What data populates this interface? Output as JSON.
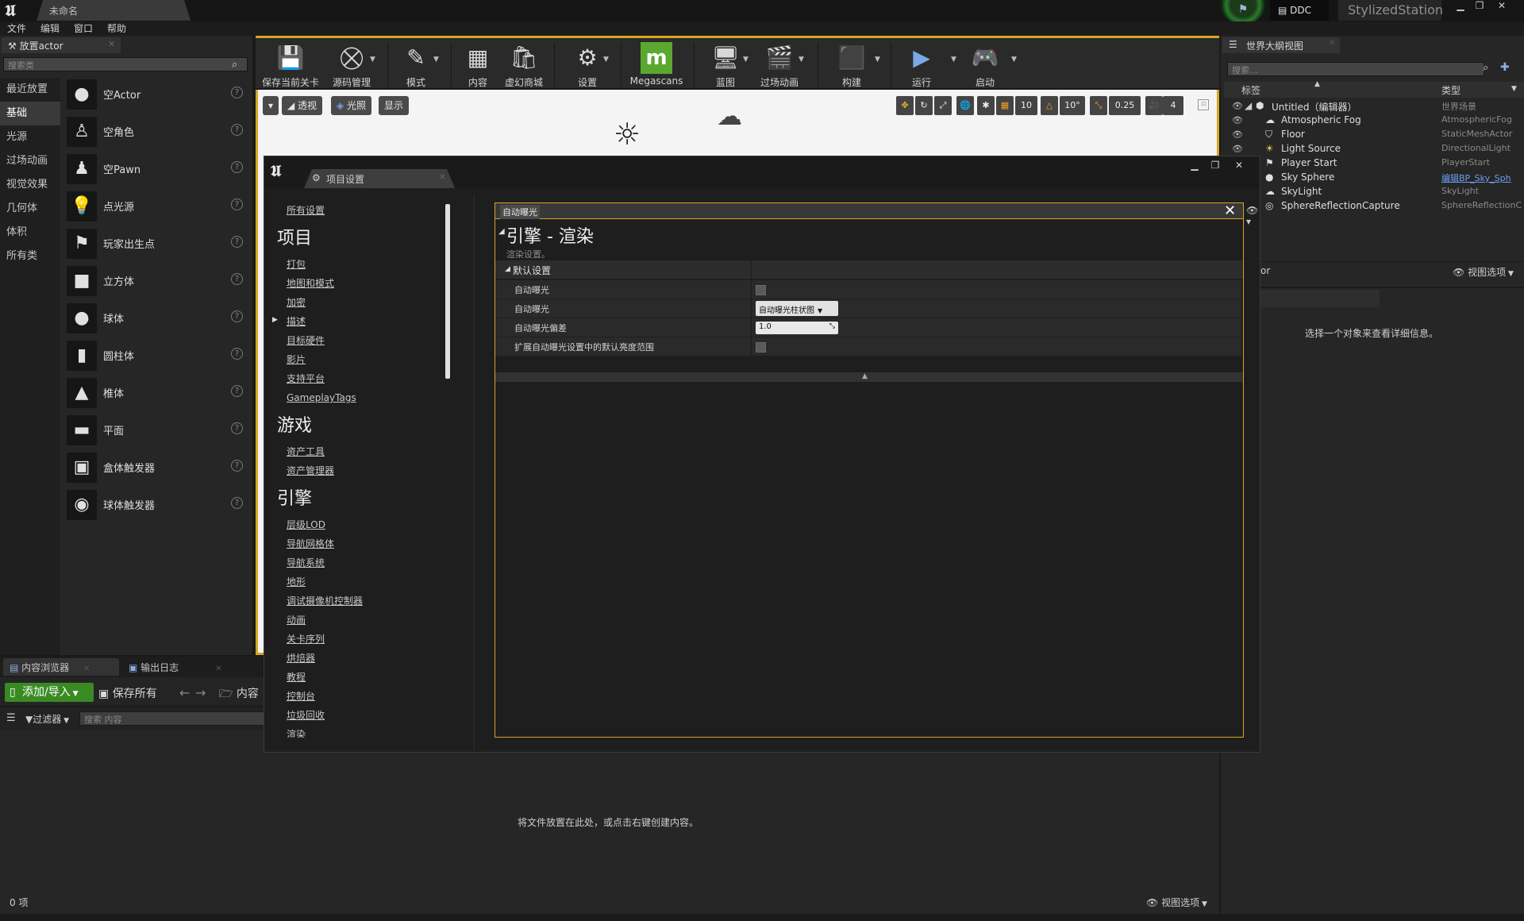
{
  "titlebar": {
    "doc_tab": "未命名",
    "ddc": "DDC",
    "project_name": "StylizedStation"
  },
  "menu": [
    "文件",
    "编辑",
    "窗口",
    "帮助"
  ],
  "place_actors": {
    "tab": "放置actor",
    "search_placeholder": "搜索类",
    "categories": [
      "最近放置",
      "基础",
      "光源",
      "过场动画",
      "视觉效果",
      "几何体",
      "体积",
      "所有类"
    ],
    "active_category": "基础",
    "actors": [
      {
        "label": "空Actor",
        "icon": "sphere-white-icon"
      },
      {
        "label": "空角色",
        "icon": "character-icon"
      },
      {
        "label": "空Pawn",
        "icon": "pawn-icon"
      },
      {
        "label": "点光源",
        "icon": "point-light-icon"
      },
      {
        "label": "玩家出生点",
        "icon": "player-start-icon"
      },
      {
        "label": "立方体",
        "icon": "cube-icon"
      },
      {
        "label": "球体",
        "icon": "sphere-icon"
      },
      {
        "label": "圆柱体",
        "icon": "cylinder-icon"
      },
      {
        "label": "椎体",
        "icon": "cone-icon"
      },
      {
        "label": "平面",
        "icon": "plane-icon"
      },
      {
        "label": "盒体触发器",
        "icon": "box-trigger-icon"
      },
      {
        "label": "球体触发器",
        "icon": "sphere-trigger-icon"
      }
    ],
    "help_glyph": "?"
  },
  "toolbar": {
    "buttons": [
      {
        "label": "保存当前关卡",
        "icon": "save-icon"
      },
      {
        "label": "源码管理",
        "icon": "source-control-icon"
      },
      {
        "label": "模式",
        "icon": "modes-icon"
      },
      {
        "label": "内容",
        "icon": "content-icon"
      },
      {
        "label": "虚幻商城",
        "icon": "marketplace-icon"
      },
      {
        "label": "设置",
        "icon": "settings-icon"
      },
      {
        "label": "Megascans",
        "icon": "megascans-icon"
      },
      {
        "label": "蓝图",
        "icon": "blueprint-icon"
      },
      {
        "label": "过场动画",
        "icon": "cinematics-icon"
      },
      {
        "label": "构建",
        "icon": "build-icon"
      },
      {
        "label": "运行",
        "icon": "play-icon"
      },
      {
        "label": "启动",
        "icon": "launch-icon"
      }
    ]
  },
  "viewport": {
    "perspective": "透视",
    "lighting": "光照",
    "show": "显示",
    "grid_snap": "10",
    "rotation_snap": "10°",
    "scale_snap": "0.25",
    "camera_speed": "4"
  },
  "content_browser": {
    "tab": "内容浏览器",
    "log_tab": "输出日志",
    "add_import": "添加/导入",
    "save_all": "保存所有",
    "path_root": "内容",
    "filters": "过滤器",
    "search_placeholder": "搜索 内容",
    "empty_hint": "将文件放置在此处，或点击右键创建内容。",
    "item_count": "0 项",
    "view_options": "视图选项"
  },
  "outliner": {
    "tab": "世界大纲视图",
    "search_placeholder": "搜索...",
    "col_label": "标签",
    "col_type": "类型",
    "rows": [
      {
        "label": "Untitled（编辑器）",
        "type": "世界场景"
      },
      {
        "label": "Atmospheric Fog",
        "type": "AtmosphericFog"
      },
      {
        "label": "Floor",
        "type": "StaticMeshActor"
      },
      {
        "label": "Light Source",
        "type": "DirectionalLight"
      },
      {
        "label": "Player Start",
        "type": "PlayerStart"
      },
      {
        "label": "Sky Sphere",
        "type": "编辑BP_Sky_Sph"
      },
      {
        "label": "SkyLight",
        "type": "SkyLight"
      },
      {
        "label": "SphereReflectionCapture",
        "type": "SphereReflectionC"
      }
    ],
    "footer_left": "or",
    "view_options": "视图选项"
  },
  "details": {
    "hint": "选择一个对象来查看详细信息。"
  },
  "project_settings": {
    "tab": "项目设置",
    "all_settings": "所有设置",
    "sections": [
      {
        "title": "项目",
        "items": [
          "打包",
          "地图和模式",
          "加密",
          "描述",
          "目标硬件",
          "影片",
          "支持平台",
          "GameplayTags"
        ]
      },
      {
        "title": "游戏",
        "items": [
          "资产工具",
          "资产管理器"
        ]
      },
      {
        "title": "引擎",
        "items": [
          "层级LOD",
          "导航网格体",
          "导航系统",
          "地形",
          "调试摄像机控制器",
          "动画",
          "关卡序列",
          "烘焙器",
          "教程",
          "控制台",
          "垃圾回收",
          "渲染"
        ]
      }
    ],
    "search_value": "自动曝光",
    "heading": "引擎 - 渲染",
    "subheading": "渲染设置。",
    "category": "默认设置",
    "properties": [
      {
        "name": "自动曝光",
        "kind": "checkbox"
      },
      {
        "name": "自动曝光",
        "kind": "dropdown",
        "value": "自动曝光柱状图"
      },
      {
        "name": "自动曝光偏差",
        "kind": "number",
        "value": "1.0"
      },
      {
        "name": "扩展自动曝光设置中的默认亮度范围",
        "kind": "checkbox"
      }
    ]
  }
}
